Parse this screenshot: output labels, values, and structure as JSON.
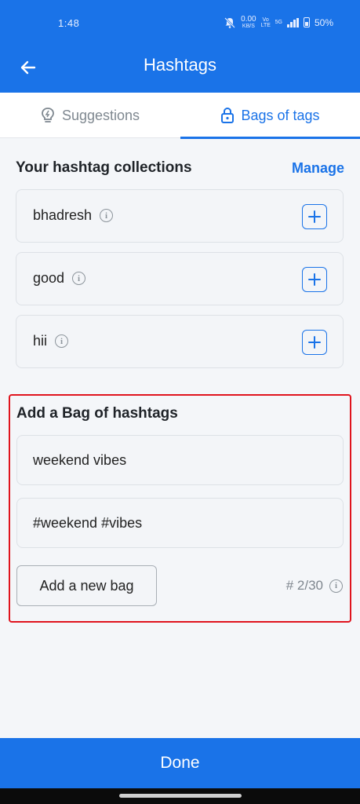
{
  "status_bar": {
    "time": "1:48",
    "net_speed": "0.00",
    "net_unit": "KB/S",
    "volte": "Vo LTE",
    "network": "5G",
    "battery": "50%"
  },
  "app_bar": {
    "title": "Hashtags",
    "back_icon": "arrow-left-icon"
  },
  "tabs": [
    {
      "label": "Suggestions",
      "icon": "lightbulb-icon",
      "selected": false
    },
    {
      "label": "Bags of tags",
      "icon": "lock-icon",
      "selected": true
    }
  ],
  "collections": {
    "heading": "Your hashtag collections",
    "manage_label": "Manage",
    "items": [
      {
        "name": "bhadresh"
      },
      {
        "name": "good"
      },
      {
        "name": "hii"
      }
    ]
  },
  "add_bag": {
    "heading": "Add a Bag of hashtags",
    "name_value": "weekend vibes",
    "tags_value": "#weekend #vibes",
    "button_label": "Add a new bag",
    "counter": "# 2/30"
  },
  "footer": {
    "done_label": "Done"
  },
  "colors": {
    "primary": "#1a73e8",
    "highlight": "#e0141e"
  }
}
